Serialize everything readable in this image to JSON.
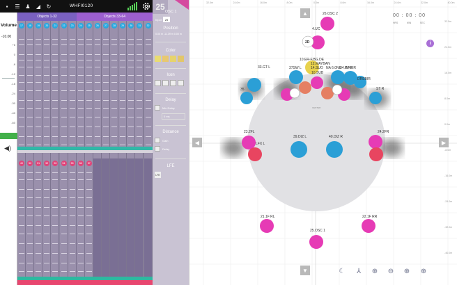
{
  "app": {
    "title": "WHFI0120",
    "topbar_icons": [
      "save-icon",
      "menu-icon",
      "person-icon",
      "speaker-icon",
      "refresh-icon"
    ],
    "settings_icon": "gear-icon"
  },
  "volume": {
    "label": "Volume",
    "value": "-10.00",
    "ticks": [
      "+6",
      "0",
      "-6",
      "-12",
      "-18",
      "-24",
      "-30",
      "-40",
      "-60"
    ],
    "meter_color": "#42b04a"
  },
  "objects": {
    "group1_label": "Objects 1-32",
    "group2_label": "Objects 33-64",
    "top_numbers": [
      "17",
      "18",
      "19",
      "20",
      "21",
      "22",
      "23",
      "24",
      "25",
      "26",
      "27",
      "28",
      "29",
      "30",
      "31",
      "32"
    ],
    "bottom_numbers": [
      "49",
      "50",
      "51",
      "52",
      "53",
      "54",
      "55",
      "56",
      "57"
    ]
  },
  "panel": {
    "object_id": "25",
    "object_name": "OSC 1",
    "input_label": "Input",
    "input_value": "25",
    "position_label": "Position",
    "position_value": "0.00 m -11.39 m 0.00 m",
    "color_label": "Color",
    "colors": [
      "#e9dc72",
      "#e8c870",
      "#e6d36c",
      "#e2c66a"
    ],
    "icon_label": "Icon",
    "delay_label": "Delay",
    "delay_opt1": "Min Delay",
    "delay_opt2": "0 ms",
    "distance_label": "Distance",
    "distance_opt1": "Gain",
    "distance_opt2": "Delay",
    "lfe_label": "LFE",
    "lfe_button": "LFE"
  },
  "map": {
    "top_axis": [
      "32.0m",
      "24.0m",
      "16.0m",
      "8.0m",
      "0.0m",
      "8.0m",
      "16.0m",
      "24.0m",
      "32.0m",
      "40.0m"
    ],
    "right_axis": [
      "32.0m",
      "24.0m",
      "16.0m",
      "8.0m",
      "0.0m",
      "-8.0m",
      "-16.0m",
      "-24.0m",
      "-32.0m",
      "-40.0m"
    ],
    "clock": "00 : 00 : 00",
    "clock_labels": [
      "HRS",
      "MIN",
      "SEC"
    ],
    "info_label": "i",
    "nav": {
      "up": "▲",
      "down": "▼",
      "left": "◀",
      "right": "▶"
    },
    "tools": [
      "night-mode-icon",
      "axes-icon",
      "zoom-in-icon",
      "zoom-out-icon",
      "zoom-fit-icon",
      "zoom-reset-icon"
    ],
    "speakers": [
      {
        "label": "26.OSC 2",
        "color": "#e63bb5"
      },
      {
        "label": "4.UC",
        "color": "#e63bb5"
      },
      {
        "label": "2D",
        "color": "#fff"
      },
      {
        "label": "10.ER-F.BG.DE",
        "color": "#e8d24d"
      },
      {
        "label": "12.MAYBAN",
        "color": "#e8d24d"
      },
      {
        "label": "14.SUO",
        "color": "#e8d24d"
      },
      {
        "label": "NA 6.0NE",
        "color": "#e8d24d"
      },
      {
        "label": "10.SUB",
        "color": "#e8d24d"
      },
      {
        "label": "33.GT L",
        "color": "#2b9fd6"
      },
      {
        "label": "37SW L",
        "color": "#2b9fd6"
      },
      {
        "label": "34.GT R",
        "color": "#2b9fd6"
      },
      {
        "label": "W+B R",
        "color": "#2b9fd6"
      },
      {
        "label": "DREBIR",
        "color": "#2b9fd6"
      },
      {
        "label": "ST R",
        "color": "#2b9fd6"
      },
      {
        "label": "35",
        "color": "#2b9fd6"
      },
      {
        "label": "23.2FL",
        "color": "#e63bb5"
      },
      {
        "label": "LFX L",
        "color": "#e63bb5"
      },
      {
        "label": "39.DIZ L",
        "color": "#2b9fd6"
      },
      {
        "label": "40.DIZ R",
        "color": "#2b9fd6"
      },
      {
        "label": "24.2FR",
        "color": "#e63bb5"
      },
      {
        "label": "21.1F RL",
        "color": "#e63bb5"
      },
      {
        "label": "22.1F RR",
        "color": "#e63bb5"
      },
      {
        "label": "25.OSC 1",
        "color": "#e63bb5"
      }
    ],
    "circle_label": "CENTER"
  }
}
